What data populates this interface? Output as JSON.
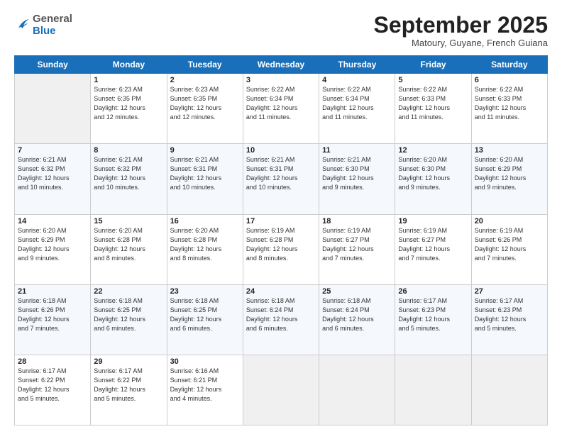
{
  "header": {
    "logo_general": "General",
    "logo_blue": "Blue",
    "month_title": "September 2025",
    "subtitle": "Matoury, Guyane, French Guiana"
  },
  "days_of_week": [
    "Sunday",
    "Monday",
    "Tuesday",
    "Wednesday",
    "Thursday",
    "Friday",
    "Saturday"
  ],
  "weeks": [
    [
      {
        "day": "",
        "info": ""
      },
      {
        "day": "1",
        "info": "Sunrise: 6:23 AM\nSunset: 6:35 PM\nDaylight: 12 hours\nand 12 minutes."
      },
      {
        "day": "2",
        "info": "Sunrise: 6:23 AM\nSunset: 6:35 PM\nDaylight: 12 hours\nand 12 minutes."
      },
      {
        "day": "3",
        "info": "Sunrise: 6:22 AM\nSunset: 6:34 PM\nDaylight: 12 hours\nand 11 minutes."
      },
      {
        "day": "4",
        "info": "Sunrise: 6:22 AM\nSunset: 6:34 PM\nDaylight: 12 hours\nand 11 minutes."
      },
      {
        "day": "5",
        "info": "Sunrise: 6:22 AM\nSunset: 6:33 PM\nDaylight: 12 hours\nand 11 minutes."
      },
      {
        "day": "6",
        "info": "Sunrise: 6:22 AM\nSunset: 6:33 PM\nDaylight: 12 hours\nand 11 minutes."
      }
    ],
    [
      {
        "day": "7",
        "info": "Sunrise: 6:21 AM\nSunset: 6:32 PM\nDaylight: 12 hours\nand 10 minutes."
      },
      {
        "day": "8",
        "info": "Sunrise: 6:21 AM\nSunset: 6:32 PM\nDaylight: 12 hours\nand 10 minutes."
      },
      {
        "day": "9",
        "info": "Sunrise: 6:21 AM\nSunset: 6:31 PM\nDaylight: 12 hours\nand 10 minutes."
      },
      {
        "day": "10",
        "info": "Sunrise: 6:21 AM\nSunset: 6:31 PM\nDaylight: 12 hours\nand 10 minutes."
      },
      {
        "day": "11",
        "info": "Sunrise: 6:21 AM\nSunset: 6:30 PM\nDaylight: 12 hours\nand 9 minutes."
      },
      {
        "day": "12",
        "info": "Sunrise: 6:20 AM\nSunset: 6:30 PM\nDaylight: 12 hours\nand 9 minutes."
      },
      {
        "day": "13",
        "info": "Sunrise: 6:20 AM\nSunset: 6:29 PM\nDaylight: 12 hours\nand 9 minutes."
      }
    ],
    [
      {
        "day": "14",
        "info": "Sunrise: 6:20 AM\nSunset: 6:29 PM\nDaylight: 12 hours\nand 9 minutes."
      },
      {
        "day": "15",
        "info": "Sunrise: 6:20 AM\nSunset: 6:28 PM\nDaylight: 12 hours\nand 8 minutes."
      },
      {
        "day": "16",
        "info": "Sunrise: 6:20 AM\nSunset: 6:28 PM\nDaylight: 12 hours\nand 8 minutes."
      },
      {
        "day": "17",
        "info": "Sunrise: 6:19 AM\nSunset: 6:28 PM\nDaylight: 12 hours\nand 8 minutes."
      },
      {
        "day": "18",
        "info": "Sunrise: 6:19 AM\nSunset: 6:27 PM\nDaylight: 12 hours\nand 7 minutes."
      },
      {
        "day": "19",
        "info": "Sunrise: 6:19 AM\nSunset: 6:27 PM\nDaylight: 12 hours\nand 7 minutes."
      },
      {
        "day": "20",
        "info": "Sunrise: 6:19 AM\nSunset: 6:26 PM\nDaylight: 12 hours\nand 7 minutes."
      }
    ],
    [
      {
        "day": "21",
        "info": "Sunrise: 6:18 AM\nSunset: 6:26 PM\nDaylight: 12 hours\nand 7 minutes."
      },
      {
        "day": "22",
        "info": "Sunrise: 6:18 AM\nSunset: 6:25 PM\nDaylight: 12 hours\nand 6 minutes."
      },
      {
        "day": "23",
        "info": "Sunrise: 6:18 AM\nSunset: 6:25 PM\nDaylight: 12 hours\nand 6 minutes."
      },
      {
        "day": "24",
        "info": "Sunrise: 6:18 AM\nSunset: 6:24 PM\nDaylight: 12 hours\nand 6 minutes."
      },
      {
        "day": "25",
        "info": "Sunrise: 6:18 AM\nSunset: 6:24 PM\nDaylight: 12 hours\nand 6 minutes."
      },
      {
        "day": "26",
        "info": "Sunrise: 6:17 AM\nSunset: 6:23 PM\nDaylight: 12 hours\nand 5 minutes."
      },
      {
        "day": "27",
        "info": "Sunrise: 6:17 AM\nSunset: 6:23 PM\nDaylight: 12 hours\nand 5 minutes."
      }
    ],
    [
      {
        "day": "28",
        "info": "Sunrise: 6:17 AM\nSunset: 6:22 PM\nDaylight: 12 hours\nand 5 minutes."
      },
      {
        "day": "29",
        "info": "Sunrise: 6:17 AM\nSunset: 6:22 PM\nDaylight: 12 hours\nand 5 minutes."
      },
      {
        "day": "30",
        "info": "Sunrise: 6:16 AM\nSunset: 6:21 PM\nDaylight: 12 hours\nand 4 minutes."
      },
      {
        "day": "",
        "info": ""
      },
      {
        "day": "",
        "info": ""
      },
      {
        "day": "",
        "info": ""
      },
      {
        "day": "",
        "info": ""
      }
    ]
  ]
}
